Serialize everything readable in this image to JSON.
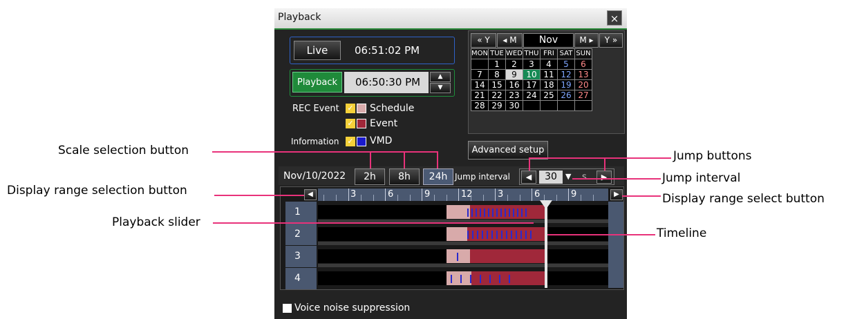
{
  "window": {
    "title": "Playback",
    "close_label": "×"
  },
  "live": {
    "button_label": "Live",
    "time": "06:51:02 PM"
  },
  "playback": {
    "button_label": "Playback",
    "time": "06:50:30 PM"
  },
  "rec_event": {
    "label": "REC Event",
    "schedule_label": "Schedule",
    "event_label": "Event",
    "schedule_color": "#d8aaaa",
    "event_color": "#a0283a"
  },
  "information": {
    "label": "Information",
    "vmd_label": "VMD",
    "vmd_color": "#1a1acc"
  },
  "calendar": {
    "nav_year_prev": "« Y",
    "nav_month_prev": "◂ M",
    "month_label": "Nov 2022",
    "nav_month_next": "M ▸",
    "nav_year_next": "Y »",
    "weekdays": [
      "MON",
      "TUE",
      "WED",
      "THU",
      "FRI",
      "SAT",
      "SUN"
    ],
    "weeks": [
      [
        "",
        "1",
        "2",
        "3",
        "4",
        "5",
        "6"
      ],
      [
        "7",
        "8",
        "9",
        "10",
        "11",
        "12",
        "13"
      ],
      [
        "14",
        "15",
        "16",
        "17",
        "18",
        "19",
        "20"
      ],
      [
        "21",
        "22",
        "23",
        "24",
        "25",
        "26",
        "27"
      ],
      [
        "28",
        "29",
        "30",
        "",
        "",
        "",
        ""
      ]
    ],
    "selected_day": "9",
    "today": "10"
  },
  "advanced_setup_label": "Advanced setup",
  "scale": {
    "date": "Nov/10/2022",
    "buttons": [
      "2h",
      "8h",
      "24h"
    ],
    "jump_interval_label": "Jump interval",
    "jump_value": "30",
    "jump_unit": "s"
  },
  "timeline": {
    "hour_labels": [
      "3",
      "6",
      "9",
      "12",
      "3",
      "6",
      "9"
    ],
    "cameras": [
      "1",
      "2",
      "3",
      "4"
    ]
  },
  "voice_noise_label": "Voice noise suppression",
  "callouts": {
    "scale_selection": "Scale selection button",
    "display_range_selection": "Display range selection button",
    "playback_slider": "Playback slider",
    "jump_buttons": "Jump buttons",
    "jump_interval": "Jump interval",
    "display_range_select": "Display range select button",
    "timeline": "Timeline"
  }
}
